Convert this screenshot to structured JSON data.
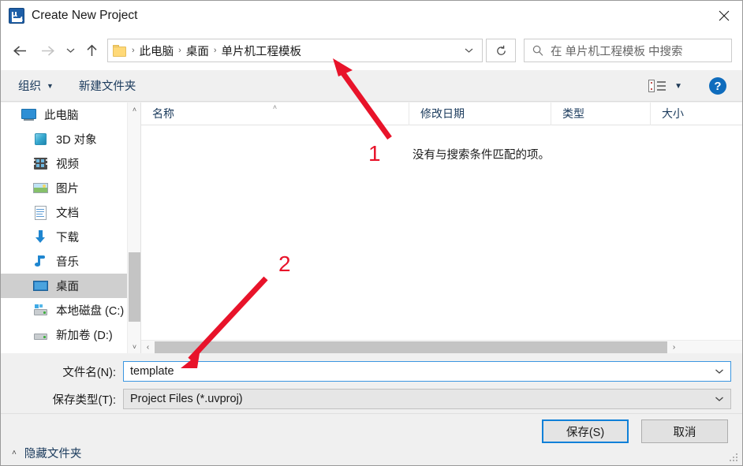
{
  "window": {
    "title": "Create New Project",
    "app_icon": "uvision-icon",
    "close_label": "✕"
  },
  "navbar": {
    "back_icon": "back-arrow-icon",
    "forward_icon": "forward-arrow-icon",
    "recent_icon": "chevron-down-icon",
    "up_icon": "up-arrow-icon",
    "breadcrumb": {
      "folder_icon": "folder-icon",
      "separator": "›",
      "items": [
        "此电脑",
        "桌面",
        "单片机工程模板"
      ]
    },
    "address_chevron": "chevron-down-icon",
    "refresh_icon": "refresh-icon",
    "search": {
      "icon": "search-icon",
      "placeholder": "在 单片机工程模板 中搜索",
      "value": ""
    }
  },
  "commandbar": {
    "organize_label": "组织",
    "organize_caret": "▼",
    "new_folder_label": "新建文件夹",
    "view_icon": "list-view-icon",
    "view_caret": "▼",
    "help_label": "?"
  },
  "navpane": {
    "items": [
      {
        "label": "此电脑",
        "icon": "this-pc-icon",
        "level": 0,
        "selected": false
      },
      {
        "label": "3D 对象",
        "icon": "3d-objects-icon",
        "level": 1,
        "selected": false
      },
      {
        "label": "视频",
        "icon": "videos-icon",
        "level": 1,
        "selected": false
      },
      {
        "label": "图片",
        "icon": "pictures-icon",
        "level": 1,
        "selected": false
      },
      {
        "label": "文档",
        "icon": "documents-icon",
        "level": 1,
        "selected": false
      },
      {
        "label": "下载",
        "icon": "downloads-icon",
        "level": 1,
        "selected": false
      },
      {
        "label": "音乐",
        "icon": "music-icon",
        "level": 1,
        "selected": false
      },
      {
        "label": "桌面",
        "icon": "desktop-icon",
        "level": 1,
        "selected": true
      },
      {
        "label": "本地磁盘 (C:)",
        "icon": "local-disk-icon",
        "level": 1,
        "selected": false
      },
      {
        "label": "新加卷 (D:)",
        "icon": "drive-icon",
        "level": 1,
        "selected": false
      }
    ],
    "scroll_up": "˄",
    "scroll_down": "˅"
  },
  "filelist": {
    "columns": [
      {
        "label": "名称",
        "sorted": true,
        "sort_mark": "˄"
      },
      {
        "label": "修改日期",
        "sorted": false,
        "sort_mark": ""
      },
      {
        "label": "类型",
        "sorted": false,
        "sort_mark": ""
      },
      {
        "label": "大小",
        "sorted": false,
        "sort_mark": ""
      }
    ],
    "rows": [],
    "empty_message": "没有与搜索条件匹配的项。",
    "hscroll_left": "‹",
    "hscroll_right": "›"
  },
  "form": {
    "filename_label": "文件名(N):",
    "filename_value": "template",
    "filetype_label": "保存类型(T):",
    "filetype_value": "Project Files (*.uvproj)",
    "combo_caret": "˅",
    "save_label": "保存(S)",
    "cancel_label": "取消",
    "hide_folders_label": "隐藏文件夹",
    "hide_folders_caret": "˄"
  },
  "annotations": {
    "accent_color": "#e8132a",
    "markers": [
      {
        "number": "1",
        "target": "address-bar-breadcrumb"
      },
      {
        "number": "2",
        "target": "filename-input"
      }
    ]
  }
}
